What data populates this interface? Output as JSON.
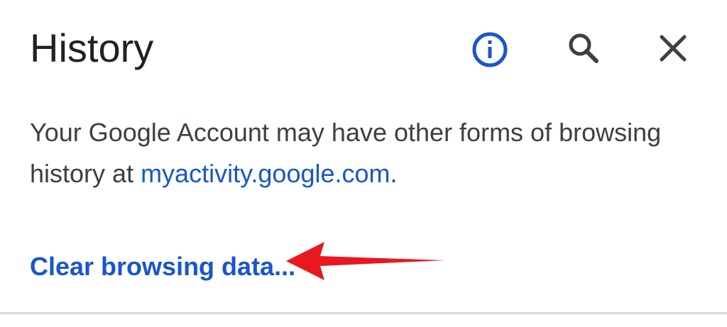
{
  "header": {
    "title": "History",
    "icons": [
      "info-icon",
      "search-icon",
      "close-icon"
    ]
  },
  "notice": {
    "text_before": "Your Google Account may have other forms of browsing history at ",
    "link_text": "myactivity.google.com",
    "text_after": "."
  },
  "actions": {
    "clear_label": "Clear browsing data..."
  },
  "colors": {
    "link": "#1a56c9",
    "text": "#3c4043",
    "annotation_arrow": "#e8181e"
  }
}
